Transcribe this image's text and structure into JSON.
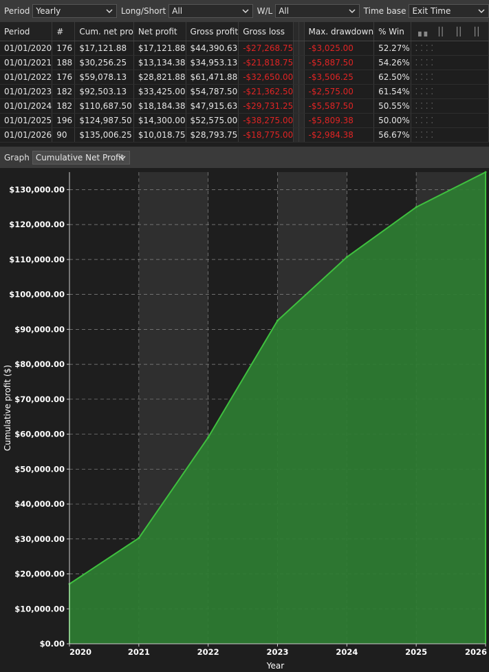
{
  "filters": {
    "period_label": "Period",
    "period_value": "Yearly",
    "longshort_label": "Long/Short",
    "longshort_value": "All",
    "wl_label": "W/L",
    "wl_value": "All",
    "timebase_label": "Time base",
    "timebase_value": "Exit Time"
  },
  "table": {
    "headers": [
      "Period",
      "#",
      "Cum. net pro",
      "Net profit",
      "Gross profit",
      "Gross loss",
      "Max. drawdown",
      "% Win"
    ],
    "rows": [
      [
        "01/01/2020",
        "176",
        "$17,121.88",
        "$17,121.88",
        "$44,390.63",
        "-$27,268.75",
        "-$3,025.00",
        "52.27%"
      ],
      [
        "01/01/2021",
        "188",
        "$30,256.25",
        "$13,134.38",
        "$34,953.13",
        "-$21,818.75",
        "-$5,887.50",
        "54.26%"
      ],
      [
        "01/01/2022",
        "176",
        "$59,078.13",
        "$28,821.88",
        "$61,471.88",
        "-$32,650.00",
        "-$3,506.25",
        "62.50%"
      ],
      [
        "01/01/2023",
        "182",
        "$92,503.13",
        "$33,425.00",
        "$54,787.50",
        "-$21,362.50",
        "-$2,575.00",
        "61.54%"
      ],
      [
        "01/01/2024",
        "182",
        "$110,687.50",
        "$18,184.38",
        "$47,915.63",
        "-$29,731.25",
        "-$5,587.50",
        "50.55%"
      ],
      [
        "01/01/2025",
        "196",
        "$124,987.50",
        "$14,300.00",
        "$52,575.00",
        "-$38,275.00",
        "-$5,809.38",
        "50.00%"
      ],
      [
        "01/01/2026",
        "90",
        "$135,006.25",
        "$10,018.75",
        "$28,793.75",
        "-$18,775.00",
        "-$2,984.38",
        "56.67%"
      ]
    ]
  },
  "graph": {
    "label": "Graph",
    "selected": "Cumulative Net Profit"
  },
  "chart_data": {
    "type": "area",
    "xlabel": "Year",
    "ylabel": "Cumulative profit ($)",
    "x": [
      2020,
      2021,
      2022,
      2023,
      2024,
      2025,
      2026
    ],
    "values": [
      17121.88,
      30256.25,
      59078.13,
      92503.13,
      110687.5,
      124987.5,
      135006.25
    ],
    "ylim": [
      0,
      135006.25
    ],
    "yticks": [
      0,
      10000,
      20000,
      30000,
      40000,
      50000,
      60000,
      70000,
      80000,
      90000,
      100000,
      110000,
      120000,
      130000
    ],
    "ytick_labels": [
      "$0.00",
      "$10,000.00",
      "$20,000.00",
      "$30,000.00",
      "$40,000.00",
      "$50,000.00",
      "$60,000.00",
      "$70,000.00",
      "$80,000.00",
      "$90,000.00",
      "$100,000.00",
      "$110,000.00",
      "$120,000.00",
      "$130,000.00"
    ],
    "xtick_labels": [
      "2020",
      "2021",
      "2022",
      "2023",
      "2024",
      "2025",
      "2026"
    ],
    "grid": true,
    "fill_color": "#2e7d32",
    "line_color": "#3fc03f",
    "band_color": "#2f2f2f",
    "background": "#1e1e1e"
  },
  "colors": {
    "negative": "#e02424",
    "accent": "#3fc03f"
  }
}
